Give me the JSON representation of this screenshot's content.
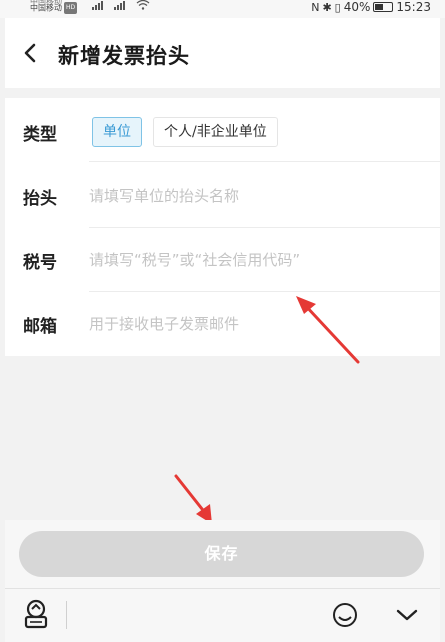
{
  "status_bar": {
    "carrier_top": "中国移动",
    "carrier": "中国移动",
    "hd_badge": "HD",
    "battery_text": "40%",
    "time": "15:23"
  },
  "header": {
    "title": "新增发票抬头",
    "back_icon": "chevron-left-icon"
  },
  "form": {
    "type": {
      "label": "类型",
      "options": [
        "单位",
        "个人/非企业单位"
      ],
      "selected": "单位"
    },
    "title_field": {
      "label": "抬头",
      "placeholder": "请填写单位的抬头名称",
      "value": ""
    },
    "tax_field": {
      "label": "税号",
      "placeholder": "请填写“税号”或“社会信用代码”",
      "value": ""
    },
    "email_field": {
      "label": "邮箱",
      "placeholder": "用于接收电子发票邮件",
      "value": ""
    }
  },
  "save_button": {
    "label": "保存",
    "enabled": false
  },
  "bottom_bar": {
    "icons": [
      "keyboard-toggle-icon",
      "emoji-icon",
      "collapse-keyboard-icon"
    ]
  },
  "colors": {
    "accent": "#3a9ad4",
    "selected_bg": "#e6f4fb",
    "annotation_arrow": "#e53935",
    "disabled_button": "#d7d7d7"
  }
}
